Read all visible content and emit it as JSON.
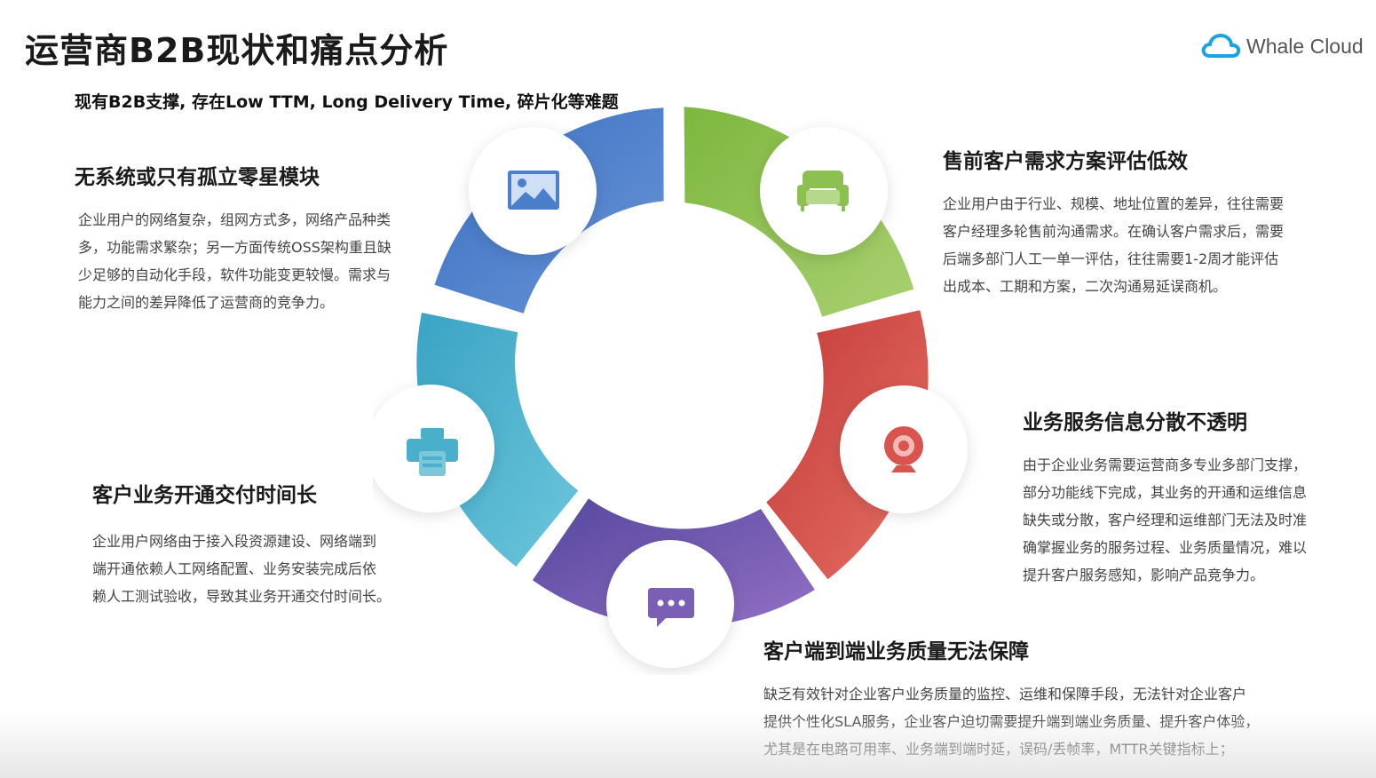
{
  "header": {
    "title": "运营商B2B现状和痛点分析",
    "subtitle": "现有B2B支撑, 存在Low TTM, Long Delivery Time, 碎片化等难题"
  },
  "logo": {
    "text": "Whale Cloud",
    "icon": "cloud-icon",
    "color": "#1aa3e0"
  },
  "segments": [
    {
      "name": "blue",
      "color_start": "#3a6ec0",
      "color_end": "#5f8fd6",
      "icon": "image-icon"
    },
    {
      "name": "green",
      "color_start": "#7db73f",
      "color_end": "#a7cf6b",
      "icon": "sofa-icon"
    },
    {
      "name": "red",
      "color_start": "#c8403f",
      "color_end": "#e06a5f",
      "icon": "webcam-icon"
    },
    {
      "name": "purple",
      "color_start": "#5a4aa0",
      "color_end": "#8d6cc0",
      "icon": "chat-icon"
    },
    {
      "name": "teal",
      "color_start": "#3aa8c8",
      "color_end": "#62c0d8",
      "icon": "printer-icon"
    }
  ],
  "pain_points": {
    "isolated": {
      "title": "无系统或只有孤立零星模块",
      "lines": [
        "企业用户的网络复杂，组网方式多，网络产品种类",
        "多，功能需求繁杂；另一方面传统OSS架构重且缺",
        "少足够的自动化手段，软件功能变更较慢。需求与",
        "能力之间的差异降低了运营商的竞争力。"
      ]
    },
    "presales": {
      "title": "售前客户需求方案评估低效",
      "lines": [
        "企业用户由于行业、规模、地址位置的差异，往往需要",
        "客户经理多轮售前沟通需求。在确认客户需求后，需要",
        "后端多部门人工一单一评估，往往需要1-2周才能评估",
        "出成本、工期和方案，二次沟通易延误商机。"
      ]
    },
    "info": {
      "title": "业务服务信息分散不透明",
      "lines": [
        "由于企业业务需要运营商多专业多部门支撑，",
        "部分功能线下完成，其业务的开通和运维信息",
        "缺失或分散，客户经理和运维部门无法及时准",
        "确掌握业务的服务过程、业务质量情况，难以",
        "提升客户服务感知，影响产品竞争力。"
      ]
    },
    "quality": {
      "title": "客户端到端业务质量无法保障",
      "lines": [
        "缺乏有效针对企业客户业务质量的监控、运维和保障手段，无法针对企业客户",
        "提供个性化SLA服务，企业客户迫切需要提升端到端业务质量、提升客户体验，",
        "尤其是在电路可用率、业务端到端时延，误码/丢帧率，MTTR关键指标上；"
      ]
    },
    "delivery": {
      "title": "客户业务开通交付时间长",
      "lines": [
        "企业用户网络由于接入段资源建设、网络端到",
        "端开通依赖人工网络配置、业务安装完成后依",
        "赖人工测试验收，导致其业务开通交付时间长。"
      ]
    }
  }
}
